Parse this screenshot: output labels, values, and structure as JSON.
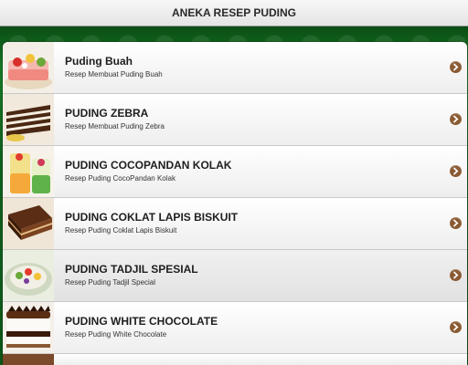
{
  "header": {
    "title": "ANEKA RESEP PUDING"
  },
  "items": [
    {
      "title": "Puding Buah",
      "subtitle": "Resep Membuat Puding Buah",
      "thumb_icon": "fruit-pudding-image"
    },
    {
      "title": "PUDING ZEBRA",
      "subtitle": "Resep Membuat Puding Zebra",
      "thumb_icon": "zebra-pudding-image"
    },
    {
      "title": "PUDING COCOPANDAN KOLAK",
      "subtitle": "Resep Puding CocoPandan Kolak",
      "thumb_icon": "cocopandan-pudding-image"
    },
    {
      "title": "PUDING COKLAT LAPIS BISKUIT",
      "subtitle": "Resep Puding Coklat Lapis Biskuit",
      "thumb_icon": "chocolate-biscuit-pudding-image"
    },
    {
      "title": "PUDING TADJIL SPESIAL",
      "subtitle": "Resep Puding Tadjil Special",
      "thumb_icon": "tadjil-pudding-image"
    },
    {
      "title": "PUDING WHITE CHOCOLATE",
      "subtitle": "Resep Puding White Chocolate",
      "thumb_icon": "white-chocolate-pudding-image"
    }
  ],
  "colors": {
    "background_green": "#0f5f1c",
    "chevron": "#8a5a33"
  }
}
